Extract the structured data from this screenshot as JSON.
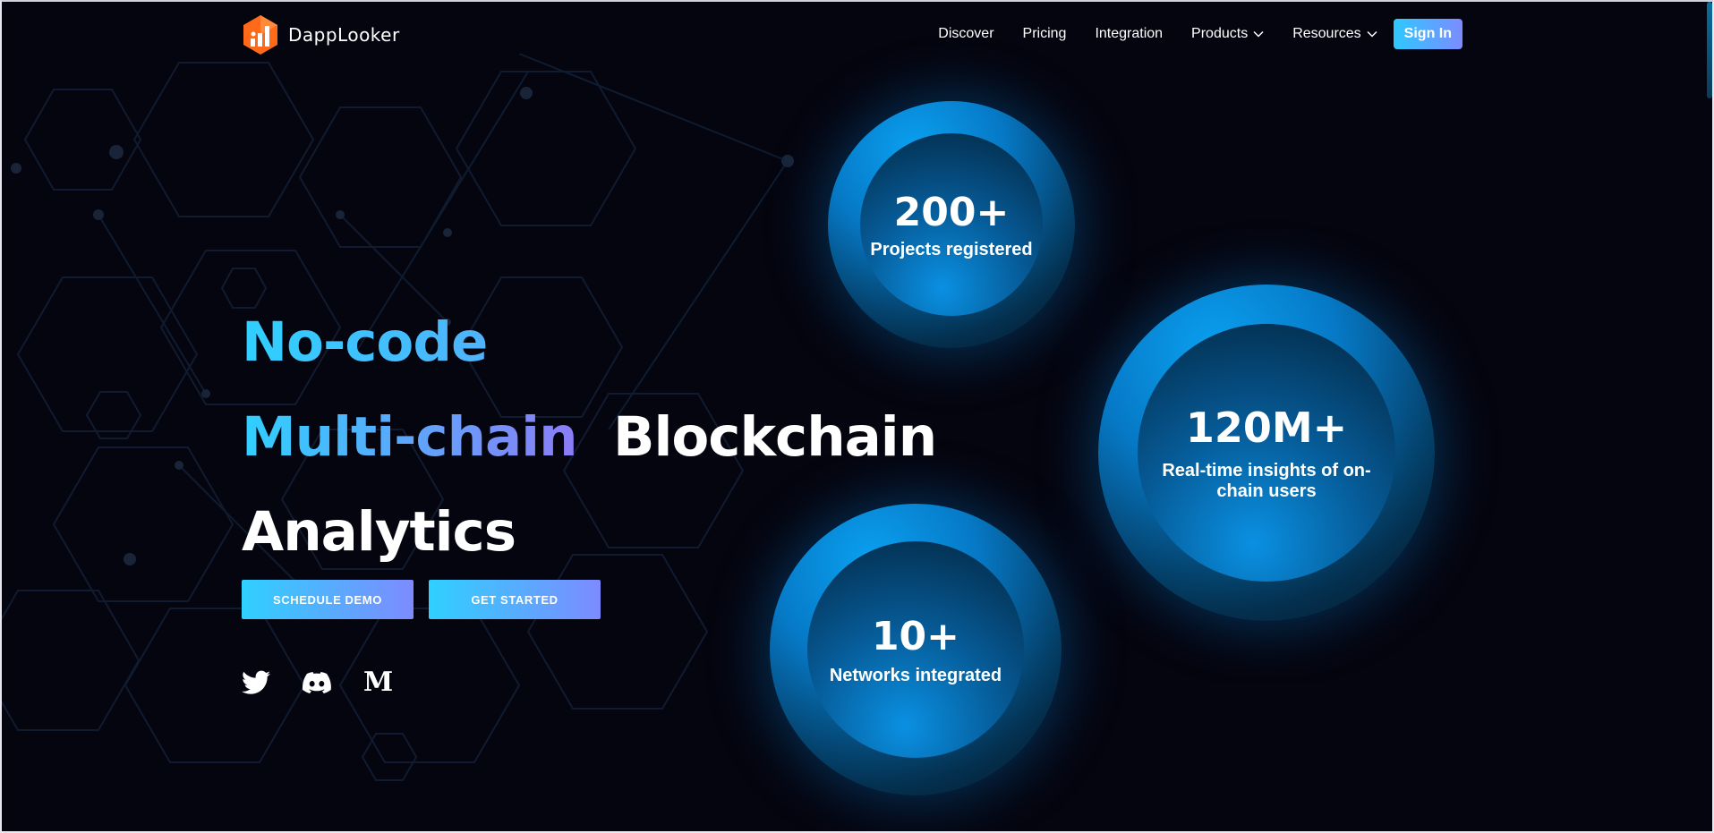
{
  "brand": {
    "name": "DappLooker"
  },
  "nav": {
    "items": [
      {
        "label": "Discover"
      },
      {
        "label": "Pricing"
      },
      {
        "label": "Integration"
      },
      {
        "label": "Products",
        "dropdown": true
      },
      {
        "label": "Resources",
        "dropdown": true
      }
    ],
    "signin_label": "Sign In"
  },
  "hero": {
    "line1": "No-code",
    "line2a": "Multi-chain",
    "line2b": "Blockchain",
    "line3": "Analytics"
  },
  "buttons": {
    "schedule_demo": "SCHEDULE DEMO",
    "get_started": "GET STARTED"
  },
  "social": {
    "icons": [
      "twitter-icon",
      "discord-icon",
      "medium-icon"
    ],
    "medium_glyph": "M"
  },
  "stats": [
    {
      "value": "200+",
      "label": "Projects registered"
    },
    {
      "value": "120M+",
      "label_line1": "Real-time insights of on-",
      "label_line2": "chain users"
    },
    {
      "value": "10+",
      "label": "Networks integrated"
    }
  ],
  "colors": {
    "background": "#05050f",
    "accent_start": "#2fd0ff",
    "accent_end": "#7d8bff",
    "logo_orange": "#ff6a1a",
    "circle_blue": "#0679c6"
  }
}
